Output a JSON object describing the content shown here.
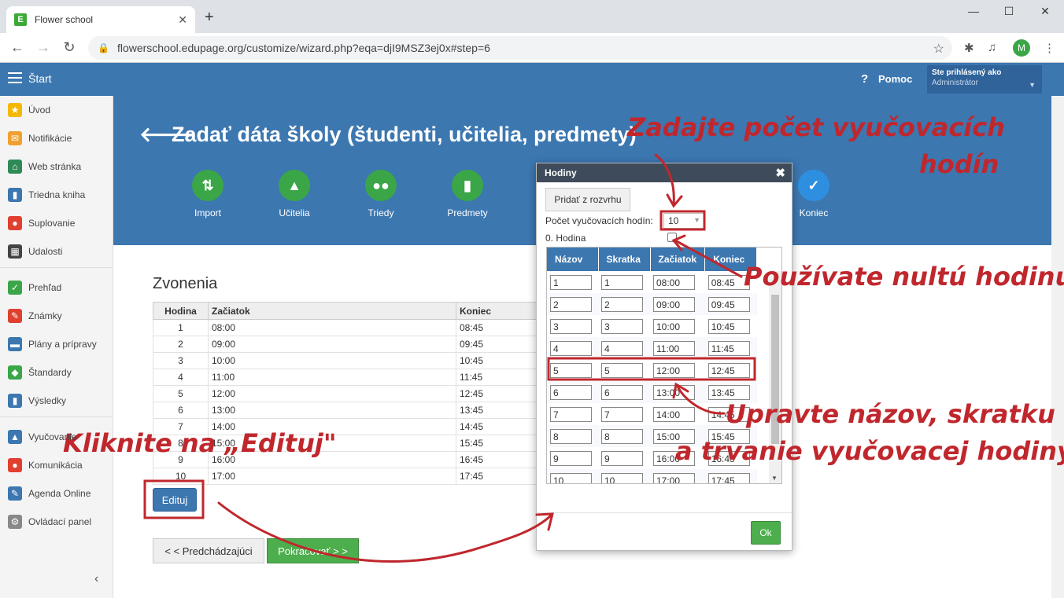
{
  "browser": {
    "tab_title": "Flower school",
    "url": "flowerschool.edupage.org/customize/wizard.php?eqa=djI9MSZ3ej0x#step=6",
    "avatar_letter": "M"
  },
  "header": {
    "start_label": "Štart",
    "help_label": "Pomoc",
    "user_line1": "Ste prihlásený ako",
    "user_line2": "Administrátor"
  },
  "sidebar": {
    "items": [
      {
        "label": "Úvod",
        "icon": "star-icon",
        "color": "#f5b800"
      },
      {
        "label": "Notifikácie",
        "icon": "envelope-icon",
        "color": "#f0a030"
      },
      {
        "label": "Web stránka",
        "icon": "home-icon",
        "color": "#2e8b57"
      },
      {
        "label": "Triedna kniha",
        "icon": "book-icon",
        "color": "#3c77b0"
      },
      {
        "label": "Suplovanie",
        "icon": "person-icon",
        "color": "#e04030"
      },
      {
        "label": "Udalosti",
        "icon": "calendar-icon",
        "color": "#444444"
      },
      {
        "label": "Prehľad",
        "icon": "check-icon",
        "color": "#3aa648"
      },
      {
        "label": "Známky",
        "icon": "grade-icon",
        "color": "#e04030"
      },
      {
        "label": "Plány a prípravy",
        "icon": "briefcase-icon",
        "color": "#3c77b0"
      },
      {
        "label": "Štandardy",
        "icon": "shield-icon",
        "color": "#3aa648"
      },
      {
        "label": "Výsledky",
        "icon": "bar-chart-icon",
        "color": "#3c77b0"
      },
      {
        "label": "Vyučovanie",
        "icon": "school-icon",
        "color": "#3c77b0"
      },
      {
        "label": "Komunikácia",
        "icon": "chat-icon",
        "color": "#e04030"
      },
      {
        "label": "Agenda Online",
        "icon": "pen-icon",
        "color": "#3c77b0"
      },
      {
        "label": "Ovládací panel",
        "icon": "gear-icon",
        "color": "#888888"
      }
    ]
  },
  "banner": {
    "title": "Zadať dáta školy (študenti, učitelia, predmety)",
    "steps": [
      {
        "label": "Import",
        "icon": "import-icon"
      },
      {
        "label": "Učitelia",
        "icon": "graduation-cap-icon"
      },
      {
        "label": "Triedy",
        "icon": "group-icon"
      },
      {
        "label": "Predmety",
        "icon": "book-icon"
      },
      {
        "label": "Koniec",
        "icon": "check-icon"
      }
    ]
  },
  "bells": {
    "title": "Zvonenia",
    "headers": [
      "Hodina",
      "Začiatok",
      "Koniec"
    ],
    "rows": [
      [
        "1",
        "08:00",
        "08:45"
      ],
      [
        "2",
        "09:00",
        "09:45"
      ],
      [
        "3",
        "10:00",
        "10:45"
      ],
      [
        "4",
        "11:00",
        "11:45"
      ],
      [
        "5",
        "12:00",
        "12:45"
      ],
      [
        "6",
        "13:00",
        "13:45"
      ],
      [
        "7",
        "14:00",
        "14:45"
      ],
      [
        "8",
        "15:00",
        "15:45"
      ],
      [
        "9",
        "16:00",
        "16:45"
      ],
      [
        "10",
        "17:00",
        "17:45"
      ]
    ],
    "edit_label": "Edituj",
    "prev_label": "< < Predchádzajúci",
    "next_label": "Pokračovať > >"
  },
  "dialog": {
    "title": "Hodiny",
    "add_label": "Pridať z rozvrhu",
    "count_label": "Počet vyučovacích hodín:",
    "count_value": "10",
    "zero_label": "0. Hodina",
    "headers": [
      "Názov",
      "Skratka",
      "Začiatok",
      "Koniec"
    ],
    "rows": [
      [
        "1",
        "1",
        "08:00",
        "08:45"
      ],
      [
        "2",
        "2",
        "09:00",
        "09:45"
      ],
      [
        "3",
        "3",
        "10:00",
        "10:45"
      ],
      [
        "4",
        "4",
        "11:00",
        "11:45"
      ],
      [
        "5",
        "5",
        "12:00",
        "12:45"
      ],
      [
        "6",
        "6",
        "13:00",
        "13:45"
      ],
      [
        "7",
        "7",
        "14:00",
        "14:45"
      ],
      [
        "8",
        "8",
        "15:00",
        "15:45"
      ],
      [
        "9",
        "9",
        "16:00",
        "16:45"
      ],
      [
        "10",
        "10",
        "17:00",
        "17:45"
      ]
    ],
    "ok_label": "Ok"
  },
  "annotations": {
    "count_note_l1": "Zadajte počet vyučovacích",
    "count_note_l2": "hodín",
    "zero_note": "Používate nultú hodinu?",
    "edit_note_l1": "Upravte názov, skratku",
    "edit_note_l2": "a trvanie vyučovacej hodiny",
    "click_note": "Kliknite na „Edituj\""
  }
}
